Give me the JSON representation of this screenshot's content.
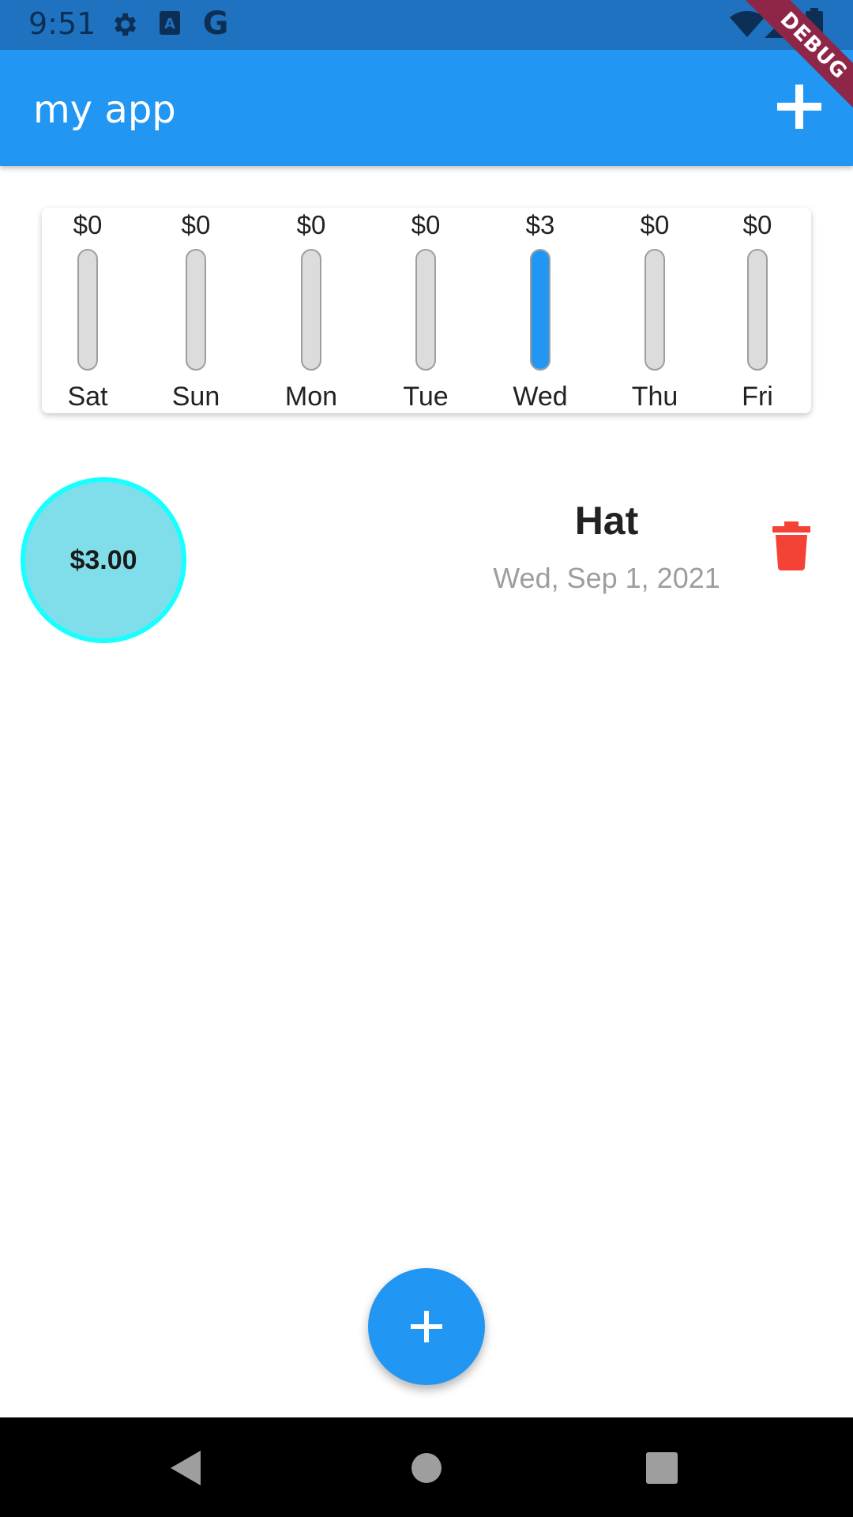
{
  "status_bar": {
    "time": "9:51",
    "icons": [
      "settings-icon",
      "font-a-icon",
      "google-g-icon",
      "wifi-icon",
      "cellular-icon",
      "battery-icon"
    ]
  },
  "app_bar": {
    "title": "my app",
    "action_icon": "add-icon"
  },
  "debug_banner": "DEBUG",
  "chart_data": {
    "type": "bar",
    "categories": [
      "Sat",
      "Sun",
      "Mon",
      "Tue",
      "Wed",
      "Thu",
      "Fri"
    ],
    "values": [
      0,
      0,
      0,
      0,
      3,
      0,
      0
    ],
    "value_labels": [
      "$0",
      "$0",
      "$0",
      "$0",
      "$3",
      "$0",
      "$0"
    ],
    "title": "",
    "xlabel": "",
    "ylabel": "",
    "ylim": [
      0,
      3
    ],
    "fill_color": "#2196f3",
    "track_color": "#dcdcdc"
  },
  "transactions": [
    {
      "amount": "$3.00",
      "title": "Hat",
      "date": "Wed, Sep 1, 2021",
      "delete_icon": "trash-icon"
    }
  ],
  "fab_icon": "add-icon",
  "nav_bar": {
    "buttons": [
      "back-icon",
      "home-icon",
      "recents-icon"
    ]
  },
  "colors": {
    "primary": "#2196f3",
    "status_bar": "#1e72c0",
    "delete": "#f44336",
    "amount_circle_fill": "#80deea",
    "amount_circle_border": "#18ffff",
    "date_text": "#9e9e9e"
  }
}
